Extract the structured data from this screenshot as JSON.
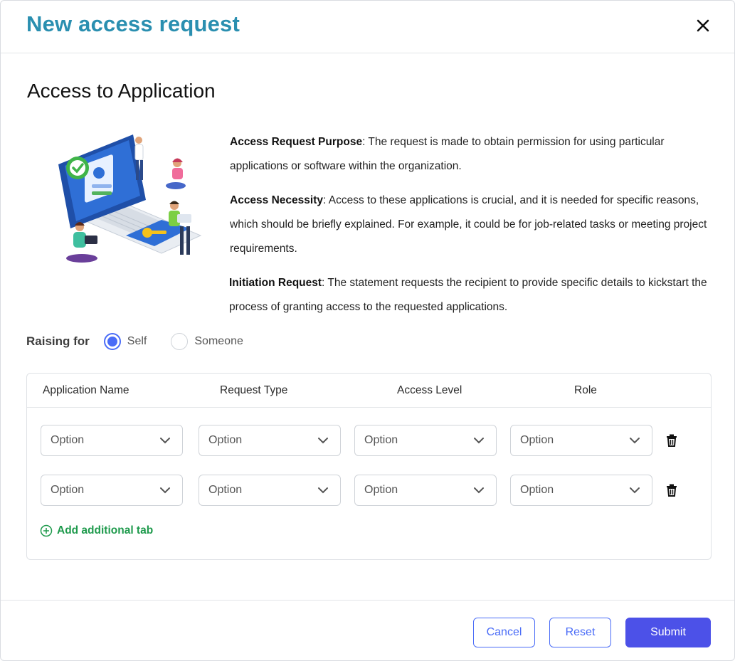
{
  "modal": {
    "title": "New access request",
    "close_icon": "close-icon"
  },
  "section": {
    "title": "Access to Application"
  },
  "info": [
    {
      "heading": "Access Request Purpose",
      "text": ": The request is made to obtain permission for using particular applications or software within the organization."
    },
    {
      "heading": "Access Necessity",
      "text": ": Access to these applications is crucial, and it is needed for specific reasons, which should be briefly explained. For example, it could be for job-related tasks or meeting project requirements."
    },
    {
      "heading": "Initiation Request",
      "text": ": The statement requests the recipient to provide specific details to kickstart the process of granting access to the requested applications."
    }
  ],
  "raising": {
    "label": "Raising for",
    "options": [
      {
        "label": "Self",
        "checked": true
      },
      {
        "label": "Someone",
        "checked": false
      }
    ]
  },
  "table": {
    "headers": [
      "Application Name",
      "Request Type",
      "Access Level",
      "Role"
    ],
    "rows": [
      [
        "Option",
        "Option",
        "Option",
        "Option"
      ],
      [
        "Option",
        "Option",
        "Option",
        "Option"
      ]
    ],
    "add_label": "Add additional tab"
  },
  "footer": {
    "cancel_label": "Cancel",
    "reset_label": "Reset",
    "submit_label": "Submit"
  },
  "colors": {
    "title": "#2a8fb0",
    "accent": "#4a6cf7",
    "primary_button": "#4c51e8",
    "add_link": "#1e9a4c"
  }
}
